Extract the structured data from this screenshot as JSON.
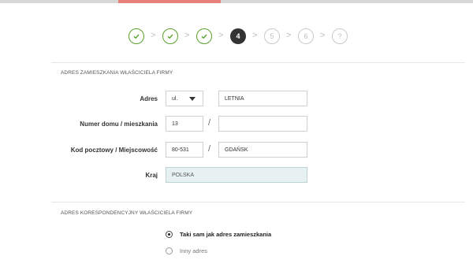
{
  "stepper": {
    "steps": [
      {
        "label": "",
        "state": "done",
        "icon": "check-icon"
      },
      {
        "label": "",
        "state": "done",
        "icon": "check-icon"
      },
      {
        "label": "",
        "state": "done",
        "icon": "check-icon"
      },
      {
        "label": "4",
        "state": "active"
      },
      {
        "label": "5",
        "state": "todo"
      },
      {
        "label": "6",
        "state": "todo"
      },
      {
        "label": "?",
        "state": "todo"
      }
    ],
    "separator": ">",
    "done_color": "#5aa02c"
  },
  "residence": {
    "title": "ADRES ZAMIESZKANIA WŁAŚCICIELA FIRMY",
    "address_label": "Adres",
    "street_prefix": "ul.",
    "street": "LETNIA",
    "house_label": "Numer domu / mieszkania",
    "house_number": "13",
    "apartment_number": "",
    "postal_label": "Kod pocztowy / Miejscowość",
    "postal_code": "80-531",
    "city": "GDAŃSK",
    "country_label": "Kraj",
    "country": "POLSKA",
    "slash": "/"
  },
  "correspondence": {
    "title": "ADRES KORESPONDENCYJNY WŁAŚCICIELA FIRMY",
    "options": [
      {
        "label": "Taki sam jak adres zamieszkania",
        "selected": true
      },
      {
        "label": "Inny adres",
        "selected": false
      }
    ]
  }
}
